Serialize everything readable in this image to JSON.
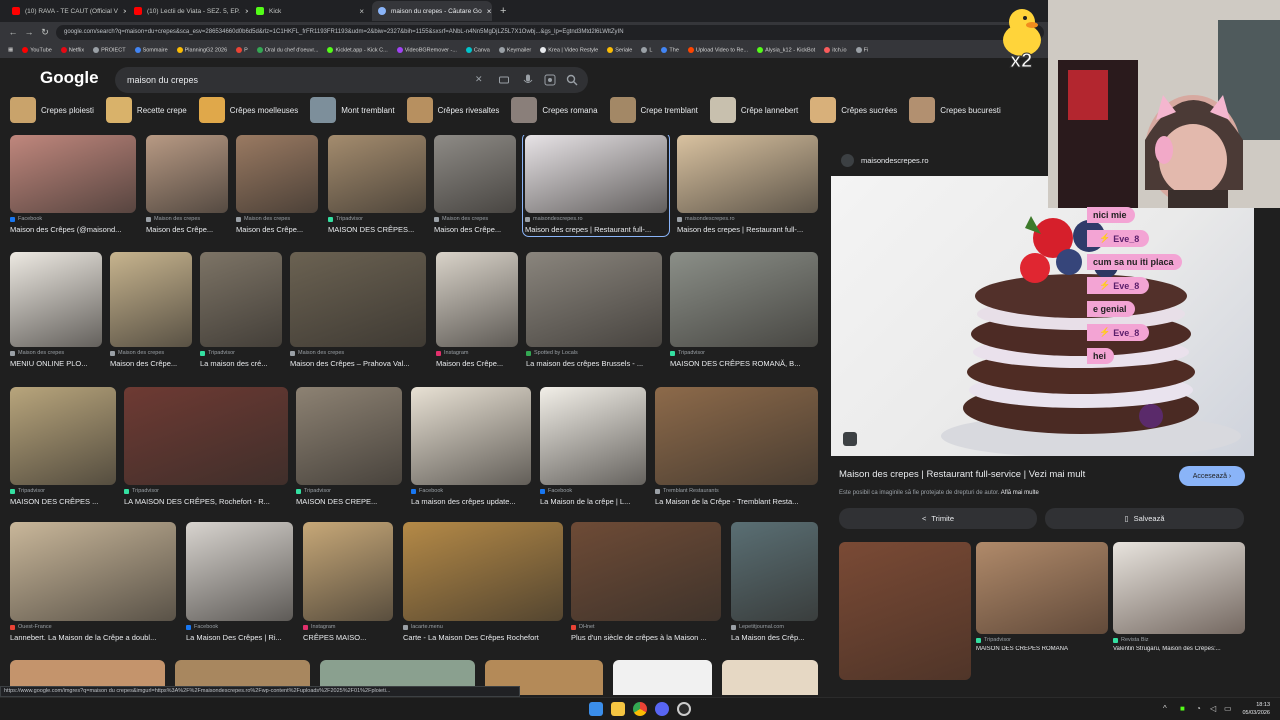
{
  "tabs": [
    {
      "title": "(10) RAVA - TE CAUT (Official V",
      "color": "#ff0000",
      "active": false
    },
    {
      "title": "(10) Lectii de Viata - SEZ. 5, EP.",
      "color": "#ff0000",
      "active": false
    },
    {
      "title": "Kick",
      "color": "#53fc18",
      "active": false
    },
    {
      "title": "maison du crepes - Căutare Go",
      "color": "#8ab4f8",
      "active": true
    }
  ],
  "new_tab": "+",
  "nav": {
    "back": "←",
    "forward": "→",
    "reload": "↻"
  },
  "url": "google.com/search?q=maison+du+crepes&sca_esv=286534660d0b6d5d&rlz=1C1HKFL_frFR1193FR1193&udm=2&biw=2327&bih=1155&sxsrf=ANbL-n4Nn5MgDjLZ5L7X1Owbj...&gs_lp=Egtnd3Mtd2l6LWltZyIN",
  "bookmarks": [
    {
      "label": "YouTube",
      "color": "#ff0000"
    },
    {
      "label": "Netflix",
      "color": "#e50914"
    },
    {
      "label": "PROIECT",
      "color": "#9aa0a6"
    },
    {
      "label": "Sommaire",
      "color": "#4285f4"
    },
    {
      "label": "PlanningG2 2026",
      "color": "#fbbc04"
    },
    {
      "label": "P",
      "color": "#ea4335"
    },
    {
      "label": "Oral du chef d'oeuvr...",
      "color": "#34a853"
    },
    {
      "label": "Kicklet.app - Kick C...",
      "color": "#53fc18"
    },
    {
      "label": "VideoBGRemover -...",
      "color": "#a142f4"
    },
    {
      "label": "Canva",
      "color": "#00c4cc"
    },
    {
      "label": "Keymailer",
      "color": "#9aa0a6"
    },
    {
      "label": "Krea | Video Restyle",
      "color": "#e8eaed"
    },
    {
      "label": "Seriale",
      "color": "#fbbc04"
    },
    {
      "label": "L",
      "color": "#9aa0a6"
    },
    {
      "label": "The",
      "color": "#4285f4"
    },
    {
      "label": "Upload Video to Re...",
      "color": "#ff4500"
    },
    {
      "label": "Alysia_k12 - KickBot",
      "color": "#53fc18"
    },
    {
      "label": "itch.io",
      "color": "#fa5c5c"
    },
    {
      "label": "Fi",
      "color": "#9aa0a6"
    }
  ],
  "google": {
    "logo": "Google",
    "query": "maison du crepes",
    "clear_icon": "✕"
  },
  "chips": [
    {
      "label": "Crepes ploiesti",
      "color": "#c9a36b"
    },
    {
      "label": "Recette crepe",
      "color": "#d9b26a"
    },
    {
      "label": "Crêpes moelleuses",
      "color": "#e0a84a"
    },
    {
      "label": "Mont tremblant",
      "color": "#7d8f9b"
    },
    {
      "label": "Crêpes rivesaltes",
      "color": "#b79060"
    },
    {
      "label": "Crepes romana",
      "color": "#8a7f7a"
    },
    {
      "label": "Crepe tremblant",
      "color": "#a38866"
    },
    {
      "label": "Crêpe lannebert",
      "color": "#c8c0ae"
    },
    {
      "label": "Crêpes sucrées",
      "color": "#d8b07a"
    },
    {
      "label": "Crepes bucuresti",
      "color": "#b29070"
    }
  ],
  "results": [
    {
      "src": "Facebook",
      "title": "Maison des Crêpes (@maisond...",
      "sc": "#1877f2",
      "img": "#c0877d"
    },
    {
      "src": "Maison des crepes",
      "title": "Maison des Crêpe...",
      "sc": "#9aa0a6",
      "img": "#b89a84"
    },
    {
      "src": "Maison des crepes",
      "title": "Maison des Crêpe...",
      "sc": "#9aa0a6",
      "img": "#9a7a62"
    },
    {
      "src": "Tripadvisor",
      "title": "MAISON DES CRÊPES...",
      "sc": "#34e0a1",
      "img": "#a48c6e"
    },
    {
      "src": "Maison des crepes",
      "title": "Maison des Crêpe...",
      "sc": "#9aa0a6",
      "img": "#8e8b86"
    },
    {
      "src": "maisondescrepes.ro",
      "title": "Maison des crepes | Restaurant full-...",
      "sc": "#9aa0a6",
      "img": "#e7e3e6"
    },
    {
      "src": "maisondescrepes.ro",
      "title": "Maison des crepes | Restaurant full-...",
      "sc": "#9aa0a6",
      "img": "#d9c2a0"
    },
    {
      "src": "Maison des crepes",
      "title": "MENIU ONLINE PLO...",
      "sc": "#9aa0a6",
      "img": "#ede9e2"
    },
    {
      "src": "Maison des crepes",
      "title": "Maison des Crêpe...",
      "sc": "#9aa0a6",
      "img": "#c7b48e"
    },
    {
      "src": "Tripadvisor",
      "title": "La maison des cré...",
      "sc": "#34e0a1",
      "img": "#7d7466"
    },
    {
      "src": "Maison des crepes",
      "title": "Maison des Crêpes – Prahova Val...",
      "sc": "#9aa0a6",
      "img": "#6b6252"
    },
    {
      "src": "Instagram",
      "title": "Maison des Crêpe...",
      "sc": "#e1306c",
      "img": "#d9d3c9"
    },
    {
      "src": "Spotted by Locals",
      "title": "La maison des crêpes Brussels - ...",
      "sc": "#34a853",
      "img": "#8a857d"
    },
    {
      "src": "Tripadvisor",
      "title": "MAISON DES CRÊPES ROMANĂ, B...",
      "sc": "#34e0a1",
      "img": "#8b8f88"
    },
    {
      "src": "Tripadvisor",
      "title": "MAISON DES CRÊPES ...",
      "sc": "#34e0a1",
      "img": "#b8a57c"
    },
    {
      "src": "Tripadvisor",
      "title": "LA MAISON DES CRÊPES, Rochefort - R...",
      "sc": "#34e0a1",
      "img": "#6e3a33"
    },
    {
      "src": "Tripadvisor",
      "title": "MAISON DES CREPE...",
      "sc": "#34e0a1",
      "img": "#8d8273"
    },
    {
      "src": "Facebook",
      "title": "La maison des crêpes update...",
      "sc": "#1877f2",
      "img": "#e8e1d4"
    },
    {
      "src": "Facebook",
      "title": "La Maison de la crêpe | L...",
      "sc": "#1877f2",
      "img": "#f2efe8"
    },
    {
      "src": "Tremblant Restaurants",
      "title": "La Maison de la Crêpe - Tremblant Resta...",
      "sc": "#9aa0a6",
      "img": "#8d6a4a"
    },
    {
      "src": "Ouest-France",
      "title": "Lannebert. La Maison de la Crêpe a doubl...",
      "sc": "#ea4335",
      "img": "#c9b79a"
    },
    {
      "src": "Facebook",
      "title": "La Maison Des Crêpes | Ri...",
      "sc": "#1877f2",
      "img": "#d8d4cf"
    },
    {
      "src": "Instagram",
      "title": "CRÊPES MAISO...",
      "sc": "#e1306c",
      "img": "#c7a878"
    },
    {
      "src": "lacarte.menu",
      "title": "Carte - La Maison Des Crêpes Rochefort",
      "sc": "#9aa0a6",
      "img": "#b58a47"
    },
    {
      "src": "DHnet",
      "title": "Plus d'un siècle de crêpes à la Maison ...",
      "sc": "#ea4335",
      "img": "#6e4b36"
    },
    {
      "src": "Lepetitjournal.com",
      "title": "La Maison des Crêp...",
      "sc": "#9aa0a6",
      "img": "#5a6f74"
    }
  ],
  "bottom_row_colors": [
    "#c4946c",
    "#a8875f",
    "#8aa08f",
    "#b48a58",
    "#f1f1f1",
    "#e6d8c4"
  ],
  "panel": {
    "source": "maisondescrepes.ro",
    "title": "Maison des crepes | Restaurant full-service | Vezi mai mult",
    "copyright": "Este posibil ca imaginile să fie protejate de drepturi de autor.",
    "learn_more": "Află mai multe",
    "visit": "Accesează",
    "share": "Trimite",
    "save": "Salvează",
    "related": [
      {
        "src": "",
        "title": "",
        "img": "#7a4a35"
      },
      {
        "src": "Tripadvisor",
        "title": "MAISON DES CRÊPES ROMANĂ",
        "img": "#b08a6a"
      },
      {
        "src": "Revista Biz",
        "title": "Valentin Strugaru, Maison des Crêpes:...",
        "img": "#e8e4de"
      }
    ]
  },
  "overlay": {
    "multiplier": "x2"
  },
  "chat": [
    {
      "user": "",
      "text": "nici mie"
    },
    {
      "user": "Eve_8",
      "text": "cum sa nu iti placa"
    },
    {
      "user": "Eve_8",
      "text": "e genial"
    },
    {
      "user": "Eve_8",
      "text": "hei"
    }
  ],
  "status_url": "https://www.google.com/imgres?q=maison du crepes&imgurl=https%3A%2F%2Fmaisondescrepes.ro%2Fwp-content%2Fuploads%2F2025%2F01%2Fploieti...",
  "clock": {
    "time": "18:13",
    "date": "05/03/2026"
  }
}
